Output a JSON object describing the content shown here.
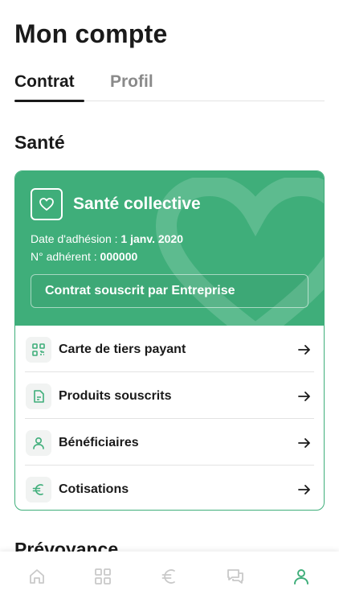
{
  "page": {
    "title": "Mon compte"
  },
  "tabs": [
    {
      "label": "Contrat",
      "active": true
    },
    {
      "label": "Profil",
      "active": false
    }
  ],
  "sections": [
    {
      "title": "Santé"
    },
    {
      "title": "Prévoyance"
    }
  ],
  "card": {
    "plan_name": "Santé collective",
    "adhesion_label": "Date d'adhésion : ",
    "adhesion_value": "1 janv. 2020",
    "member_label": "N° adhérent : ",
    "member_value": "000000",
    "contract_label": "Contrat souscrit par Entreprise",
    "icon": "heart-icon",
    "items": [
      {
        "label": "Carte de tiers payant",
        "icon": "qr-code-icon"
      },
      {
        "label": "Produits souscrits",
        "icon": "document-icon"
      },
      {
        "label": "Bénéficiaires",
        "icon": "person-icon"
      },
      {
        "label": "Cotisations",
        "icon": "euro-icon"
      }
    ]
  },
  "bottom_nav": [
    {
      "icon": "home-icon",
      "active": false
    },
    {
      "icon": "grid-icon",
      "active": false
    },
    {
      "icon": "euro-icon",
      "active": false
    },
    {
      "icon": "chat-icon",
      "active": false
    },
    {
      "icon": "profile-icon",
      "active": true
    }
  ],
  "colors": {
    "accent": "#3fae7a",
    "text": "#1a1a1a",
    "muted": "#8a8a8a",
    "nav_inactive": "#c9c9c9"
  }
}
